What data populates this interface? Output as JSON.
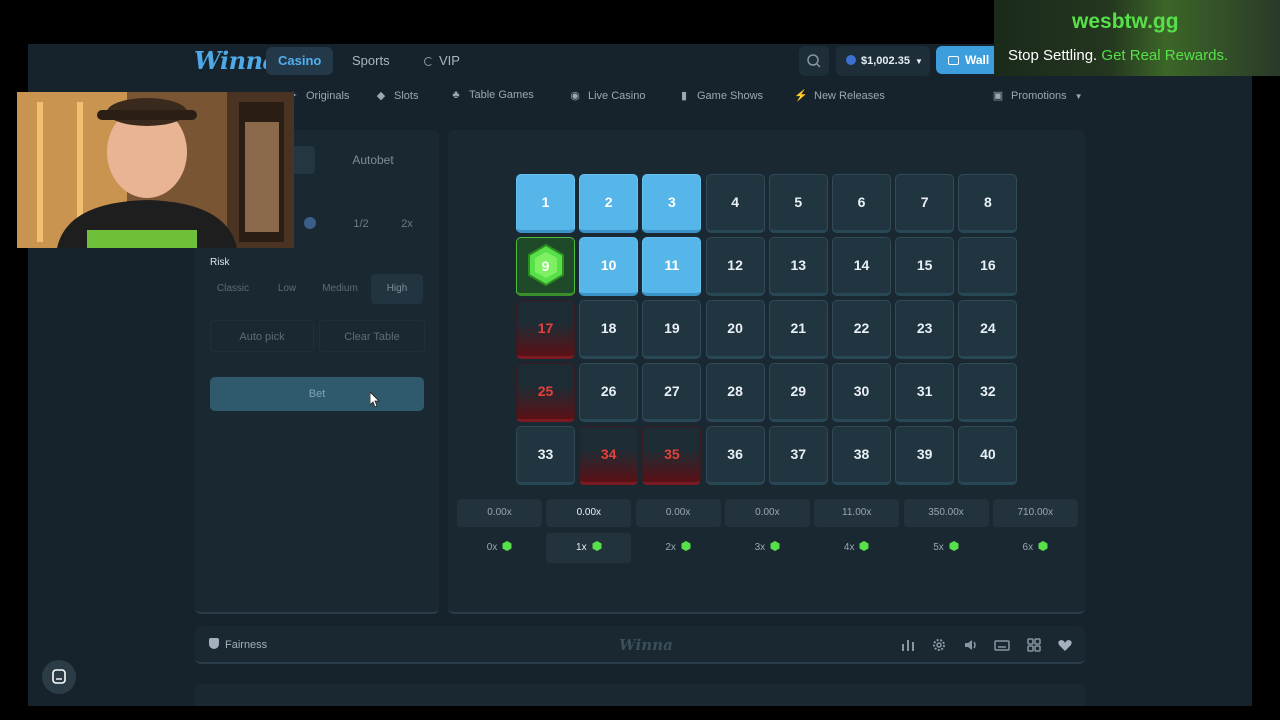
{
  "header": {
    "logo": "Winna",
    "tabs": [
      "Casino",
      "Sports",
      "VIP"
    ],
    "balance": "$1,002.35",
    "wallet_label": "Wall"
  },
  "nav": {
    "items": [
      {
        "label": "Originals",
        "icon": "sparkle-icon"
      },
      {
        "label": "Slots",
        "icon": "diamond-icon"
      },
      {
        "label": "Table Games",
        "icon": "cards-icon"
      },
      {
        "label": "Live Casino",
        "icon": "broadcast-icon"
      },
      {
        "label": "Game Shows",
        "icon": "mic-icon"
      },
      {
        "label": "New Releases",
        "icon": "bolt-icon"
      },
      {
        "label": "Promotions",
        "icon": "gift-icon"
      }
    ]
  },
  "panel": {
    "autobet_tab": "Autobet",
    "half_label": "1/2",
    "double_label": "2x",
    "risk_label": "Risk",
    "risk_options": [
      "Classic",
      "Low",
      "Medium",
      "High"
    ],
    "selected_risk": "High",
    "auto_pick": "Auto pick",
    "clear_table": "Clear Table",
    "bet_label": "Bet"
  },
  "board": {
    "tiles": [
      {
        "n": "1",
        "state": "sel"
      },
      {
        "n": "2",
        "state": "sel"
      },
      {
        "n": "3",
        "state": "sel"
      },
      {
        "n": "4",
        "state": ""
      },
      {
        "n": "5",
        "state": ""
      },
      {
        "n": "6",
        "state": ""
      },
      {
        "n": "7",
        "state": ""
      },
      {
        "n": "8",
        "state": ""
      },
      {
        "n": "9",
        "state": "hit"
      },
      {
        "n": "10",
        "state": "sel"
      },
      {
        "n": "11",
        "state": "sel"
      },
      {
        "n": "12",
        "state": ""
      },
      {
        "n": "13",
        "state": ""
      },
      {
        "n": "14",
        "state": ""
      },
      {
        "n": "15",
        "state": ""
      },
      {
        "n": "16",
        "state": ""
      },
      {
        "n": "17",
        "state": "miss"
      },
      {
        "n": "18",
        "state": ""
      },
      {
        "n": "19",
        "state": ""
      },
      {
        "n": "20",
        "state": ""
      },
      {
        "n": "21",
        "state": ""
      },
      {
        "n": "22",
        "state": ""
      },
      {
        "n": "23",
        "state": ""
      },
      {
        "n": "24",
        "state": ""
      },
      {
        "n": "25",
        "state": "miss"
      },
      {
        "n": "26",
        "state": ""
      },
      {
        "n": "27",
        "state": ""
      },
      {
        "n": "28",
        "state": ""
      },
      {
        "n": "29",
        "state": ""
      },
      {
        "n": "30",
        "state": ""
      },
      {
        "n": "31",
        "state": ""
      },
      {
        "n": "32",
        "state": ""
      },
      {
        "n": "33",
        "state": ""
      },
      {
        "n": "34",
        "state": "miss"
      },
      {
        "n": "35",
        "state": "miss"
      },
      {
        "n": "36",
        "state": ""
      },
      {
        "n": "37",
        "state": ""
      },
      {
        "n": "38",
        "state": ""
      },
      {
        "n": "39",
        "state": ""
      },
      {
        "n": "40",
        "state": ""
      }
    ],
    "payouts": [
      "0.00x",
      "0.00x",
      "0.00x",
      "0.00x",
      "11.00x",
      "350.00x",
      "710.00x"
    ],
    "hits": [
      "0x",
      "1x",
      "2x",
      "3x",
      "4x",
      "5x",
      "6x"
    ],
    "active_index": 1,
    "colors": {
      "selected": "#56b6ea",
      "miss": "#e6403b",
      "gem": "#57e04a"
    }
  },
  "footer": {
    "fairness": "Fairness",
    "logo": "Winna",
    "icons": [
      "stats-icon",
      "settings-icon",
      "volume-icon",
      "keyboard-icon",
      "grid-icon",
      "heart-icon"
    ]
  },
  "promo": {
    "site": "wesbtw.gg",
    "tagline_white": "Stop Settling.",
    "tagline_green": "Get Real Rewards."
  }
}
